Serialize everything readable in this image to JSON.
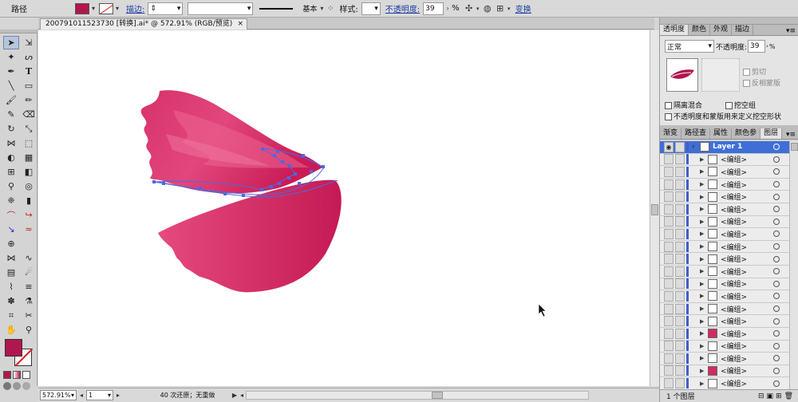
{
  "control_bar": {
    "object_type": "路径",
    "fill_color": "#b0174f",
    "stroke_label": "描边:",
    "stroke_style": "基本",
    "style_label": "样式:",
    "opacity_label": "不透明度:",
    "opacity_value": "39",
    "opacity_unit": "%",
    "transform_label": "变换"
  },
  "document": {
    "tab_title": "200791011523730 [转换].ai* @ 572.91% (RGB/预览)",
    "close_label": "×"
  },
  "status_bar": {
    "zoom": "572.91%",
    "artboard": "1",
    "undo_text": "40 次还原；无重做"
  },
  "transparency_panel": {
    "tabs": [
      "透明度",
      "颜色",
      "外观",
      "描边"
    ],
    "blend_mode": "正常",
    "opacity_label": "不透明度:",
    "opacity_value": "39",
    "opacity_unit": "%",
    "clip_label": "剪切",
    "invert_label": "反相蒙版",
    "isolate_label": "隔离混合",
    "knockout_label": "挖空组",
    "opacity_mask_label": "不透明度和蒙版用来定义挖空形状"
  },
  "layers_panel": {
    "tabs": [
      "渐变",
      "路径查",
      "属性",
      "颜色参",
      "图层"
    ],
    "layer_name": "Layer 1",
    "group_label": "<编组>",
    "footer_text": "1 个图层"
  },
  "artwork": {
    "primary_color": "#d02c63",
    "light_color": "#ef6f98",
    "path_color": "#4b6ae0"
  }
}
